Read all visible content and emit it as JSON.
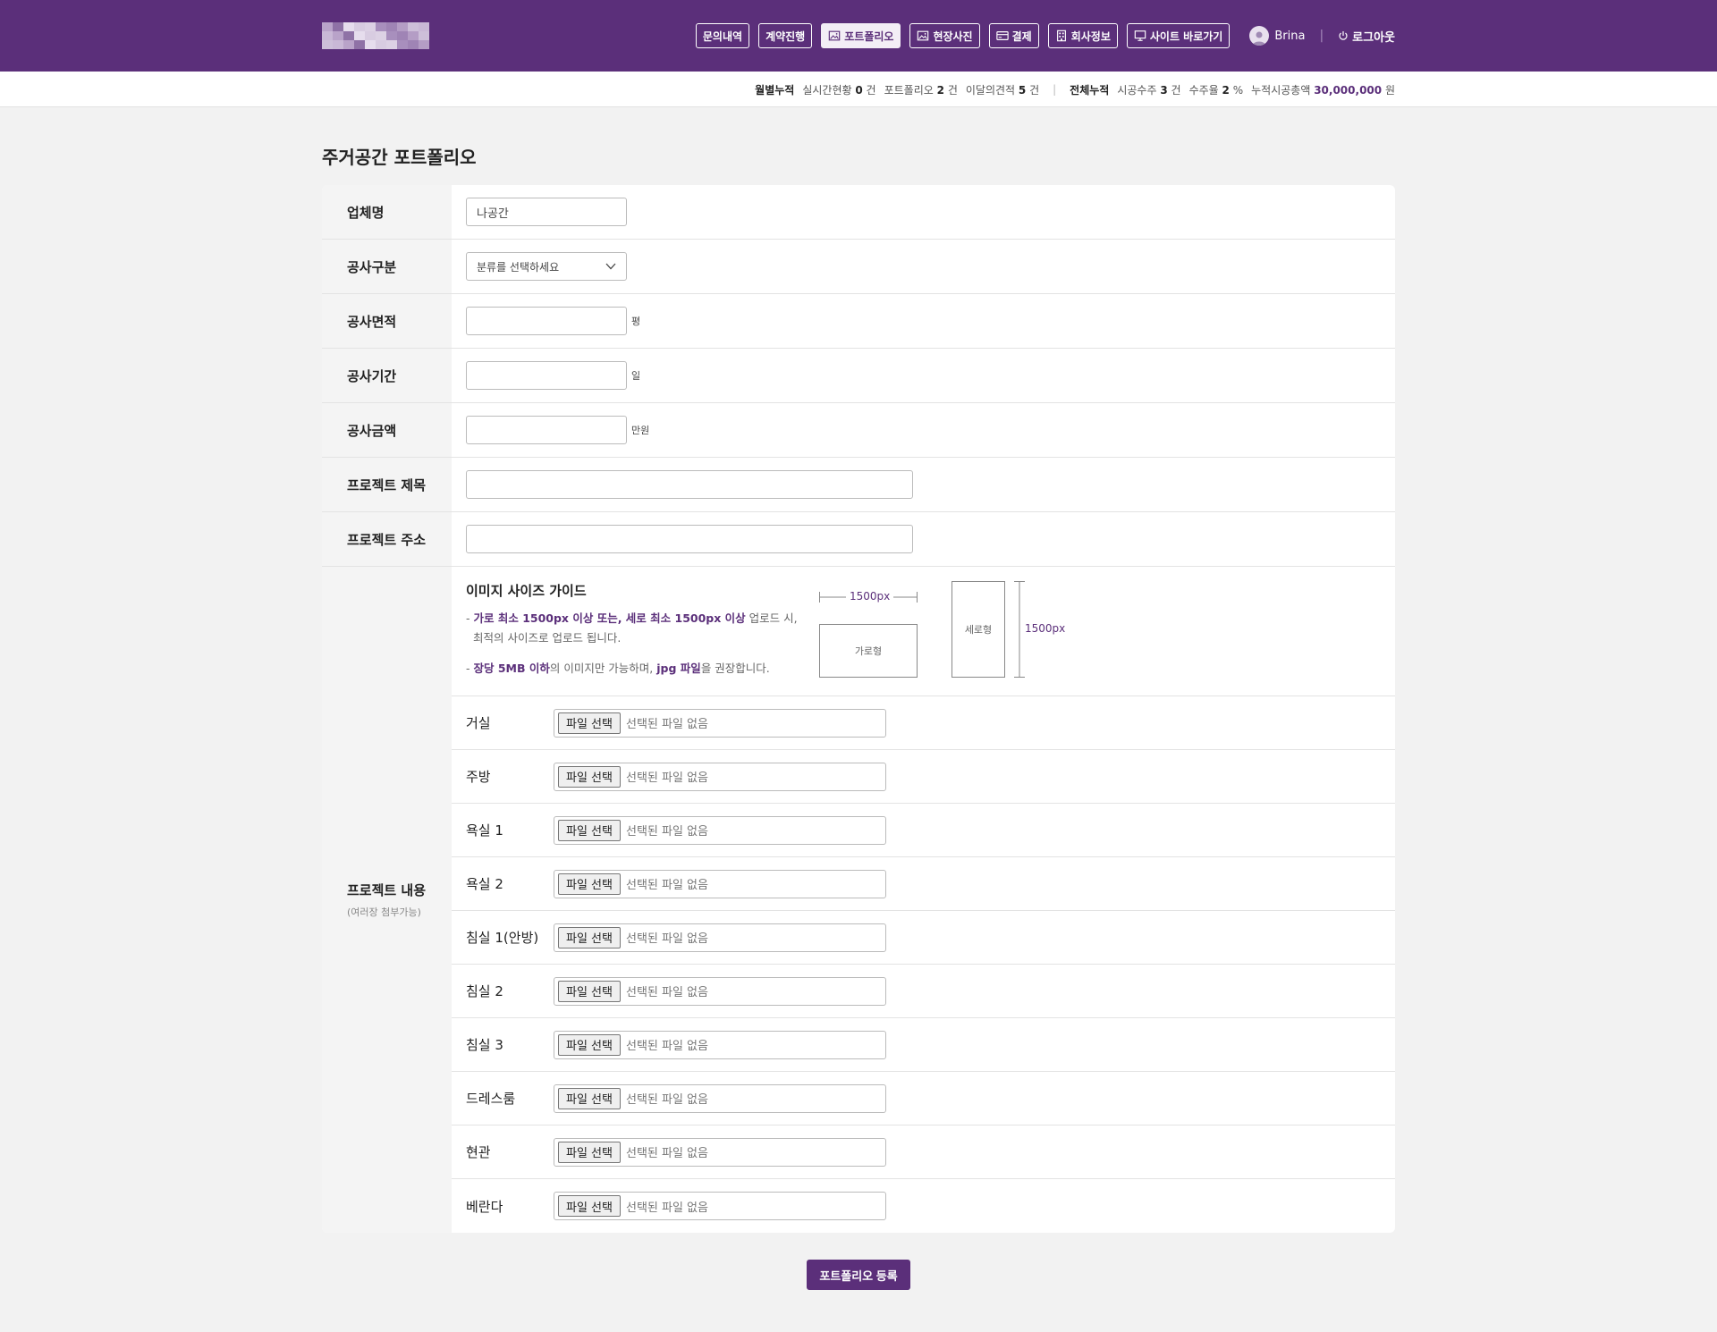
{
  "colors": {
    "brand": "#5b2f7a",
    "brand_light": "#f3eef6",
    "background": "#f2f2f2"
  },
  "header": {
    "logo_icon": "blurred-logo",
    "nav": [
      {
        "label": "문의내역",
        "icon": "",
        "active": false
      },
      {
        "label": "계약진행",
        "icon": "",
        "active": false
      },
      {
        "label": "포트폴리오",
        "icon": "image-icon",
        "active": true
      },
      {
        "label": "현장사진",
        "icon": "image-icon",
        "active": false
      },
      {
        "label": "결제",
        "icon": "card-icon",
        "active": false
      },
      {
        "label": "회사정보",
        "icon": "building-icon",
        "active": false
      },
      {
        "label": "사이트 바로가기",
        "icon": "monitor-icon",
        "active": false
      }
    ],
    "user_name": "Brina",
    "logout_label": "로그아웃"
  },
  "stats": {
    "monthly_label": "월별누적",
    "realtime_label": "실시간현황",
    "realtime_value": "0",
    "realtime_unit": "건",
    "portfolio_label": "포트폴리오",
    "portfolio_value": "2",
    "portfolio_unit": "건",
    "quote_label": "이달의견적",
    "quote_value": "5",
    "quote_unit": "건",
    "total_label": "전체누적",
    "orders_label": "시공수주",
    "orders_value": "3",
    "orders_unit": "건",
    "rate_label": "수주율",
    "rate_value": "2",
    "rate_unit": "%",
    "amount_label": "누적시공총액",
    "amount_value": "30,000,000",
    "amount_unit": "원"
  },
  "page_title": "주거공간 포트폴리오",
  "form": {
    "company": {
      "label": "업체명",
      "value": "나공간"
    },
    "type": {
      "label": "공사구분",
      "placeholder": "분류를 선택하세요"
    },
    "area": {
      "label": "공사면적",
      "unit": "평"
    },
    "period": {
      "label": "공사기간",
      "unit": "일"
    },
    "amount": {
      "label": "공사금액",
      "unit": "만원"
    },
    "title": {
      "label": "프로젝트 제목"
    },
    "address": {
      "label": "프로젝트 주소"
    },
    "content": {
      "label": "프로젝트 내용",
      "sub": "(여러장 첨부가능)"
    }
  },
  "guide": {
    "title": "이미지 사이즈 가이드",
    "line1_dash": "- ",
    "line1_hl": "가로 최소 1500px 이상 또는, 세로 최소 1500px 이상",
    "line1_rest": " 업로드 시,",
    "line1_cont": "최적의 사이즈로 업로드 됩니다.",
    "line2_dash": "- ",
    "line2_hl1": "장당 5MB 이하",
    "line2_mid": "의 이미지만 가능하며, ",
    "line2_hl2": "jpg 파일",
    "line2_rest": "을 권장합니다.",
    "horizontal_dim": "1500px",
    "horizontal_label": "가로형",
    "vertical_label": "세로형",
    "vertical_dim": "1500px"
  },
  "file_button": "파일 선택",
  "file_status": "선택된 파일 없음",
  "rooms": [
    "거실",
    "주방",
    "욕실 1",
    "욕실 2",
    "침실 1(안방)",
    "침실 2",
    "침실 3",
    "드레스룸",
    "현관",
    "베란다"
  ],
  "submit_label": "포트폴리오 등록"
}
